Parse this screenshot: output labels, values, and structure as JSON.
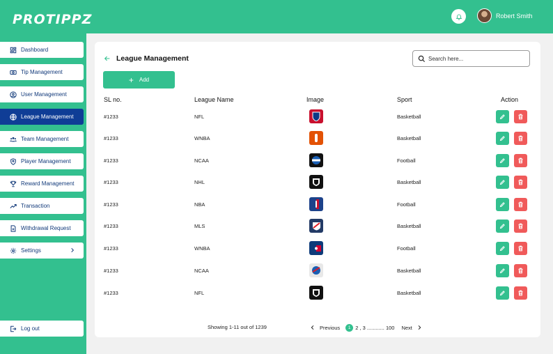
{
  "app": {
    "logo": "PROTIPPZ"
  },
  "header": {
    "user_name": "Robert Smith"
  },
  "sidebar": {
    "items": [
      {
        "label": "Dashboard",
        "icon": "dashboard-icon"
      },
      {
        "label": "Tip Management",
        "icon": "cash-icon"
      },
      {
        "label": "User Management",
        "icon": "user-circle-icon"
      },
      {
        "label": "League Management",
        "icon": "globe-icon",
        "active": true
      },
      {
        "label": "Team Management",
        "icon": "team-icon"
      },
      {
        "label": "Player Management",
        "icon": "shield-user-icon"
      },
      {
        "label": "Reward Management",
        "icon": "trophy-icon"
      },
      {
        "label": "Transaction",
        "icon": "trend-icon"
      },
      {
        "label": "Withdrawal Request",
        "icon": "document-icon"
      },
      {
        "label": "Settings",
        "icon": "gear-icon"
      }
    ],
    "logout": "Log out"
  },
  "main": {
    "title": "League Management",
    "search_placeholder": "Search here...",
    "add_label": "Add",
    "columns": [
      "SL no.",
      "League Name",
      "Image",
      "Sport",
      "Action"
    ],
    "rows": [
      {
        "sl": "#1233",
        "league": "NFL",
        "sport": "Basketball",
        "logo_color": "#c8102e"
      },
      {
        "sl": "#1233",
        "league": "WNBA",
        "sport": "Basketball",
        "logo_color": "#e35205"
      },
      {
        "sl": "#1233",
        "league": "NCAA",
        "sport": "Football",
        "logo_color": "#111111"
      },
      {
        "sl": "#1233",
        "league": "NHL",
        "sport": "Basketball",
        "logo_color": "#111111"
      },
      {
        "sl": "#1233",
        "league": "NBA",
        "sport": "Football",
        "logo_color": "#1d428a"
      },
      {
        "sl": "#1233",
        "league": "MLS",
        "sport": "Basketball",
        "logo_color": "#233b66"
      },
      {
        "sl": "#1233",
        "league": "WNBA",
        "sport": "Football",
        "logo_color": "#0e3b7a"
      },
      {
        "sl": "#1233",
        "league": "NCAA",
        "sport": "Basketball",
        "logo_color": "#e8e8e8"
      },
      {
        "sl": "#1233",
        "league": "NFL",
        "sport": "Basketball",
        "logo_color": "#111111"
      }
    ],
    "pagination": {
      "showing": "Showing 1-11 out of  1239",
      "previous": "Previous",
      "current": "1",
      "pages": "2 , 3 ............ 100",
      "next": "Next"
    }
  },
  "colors": {
    "brand": "#33c08f",
    "active_nav": "#0f3d96",
    "delete": "#f05a5a"
  }
}
